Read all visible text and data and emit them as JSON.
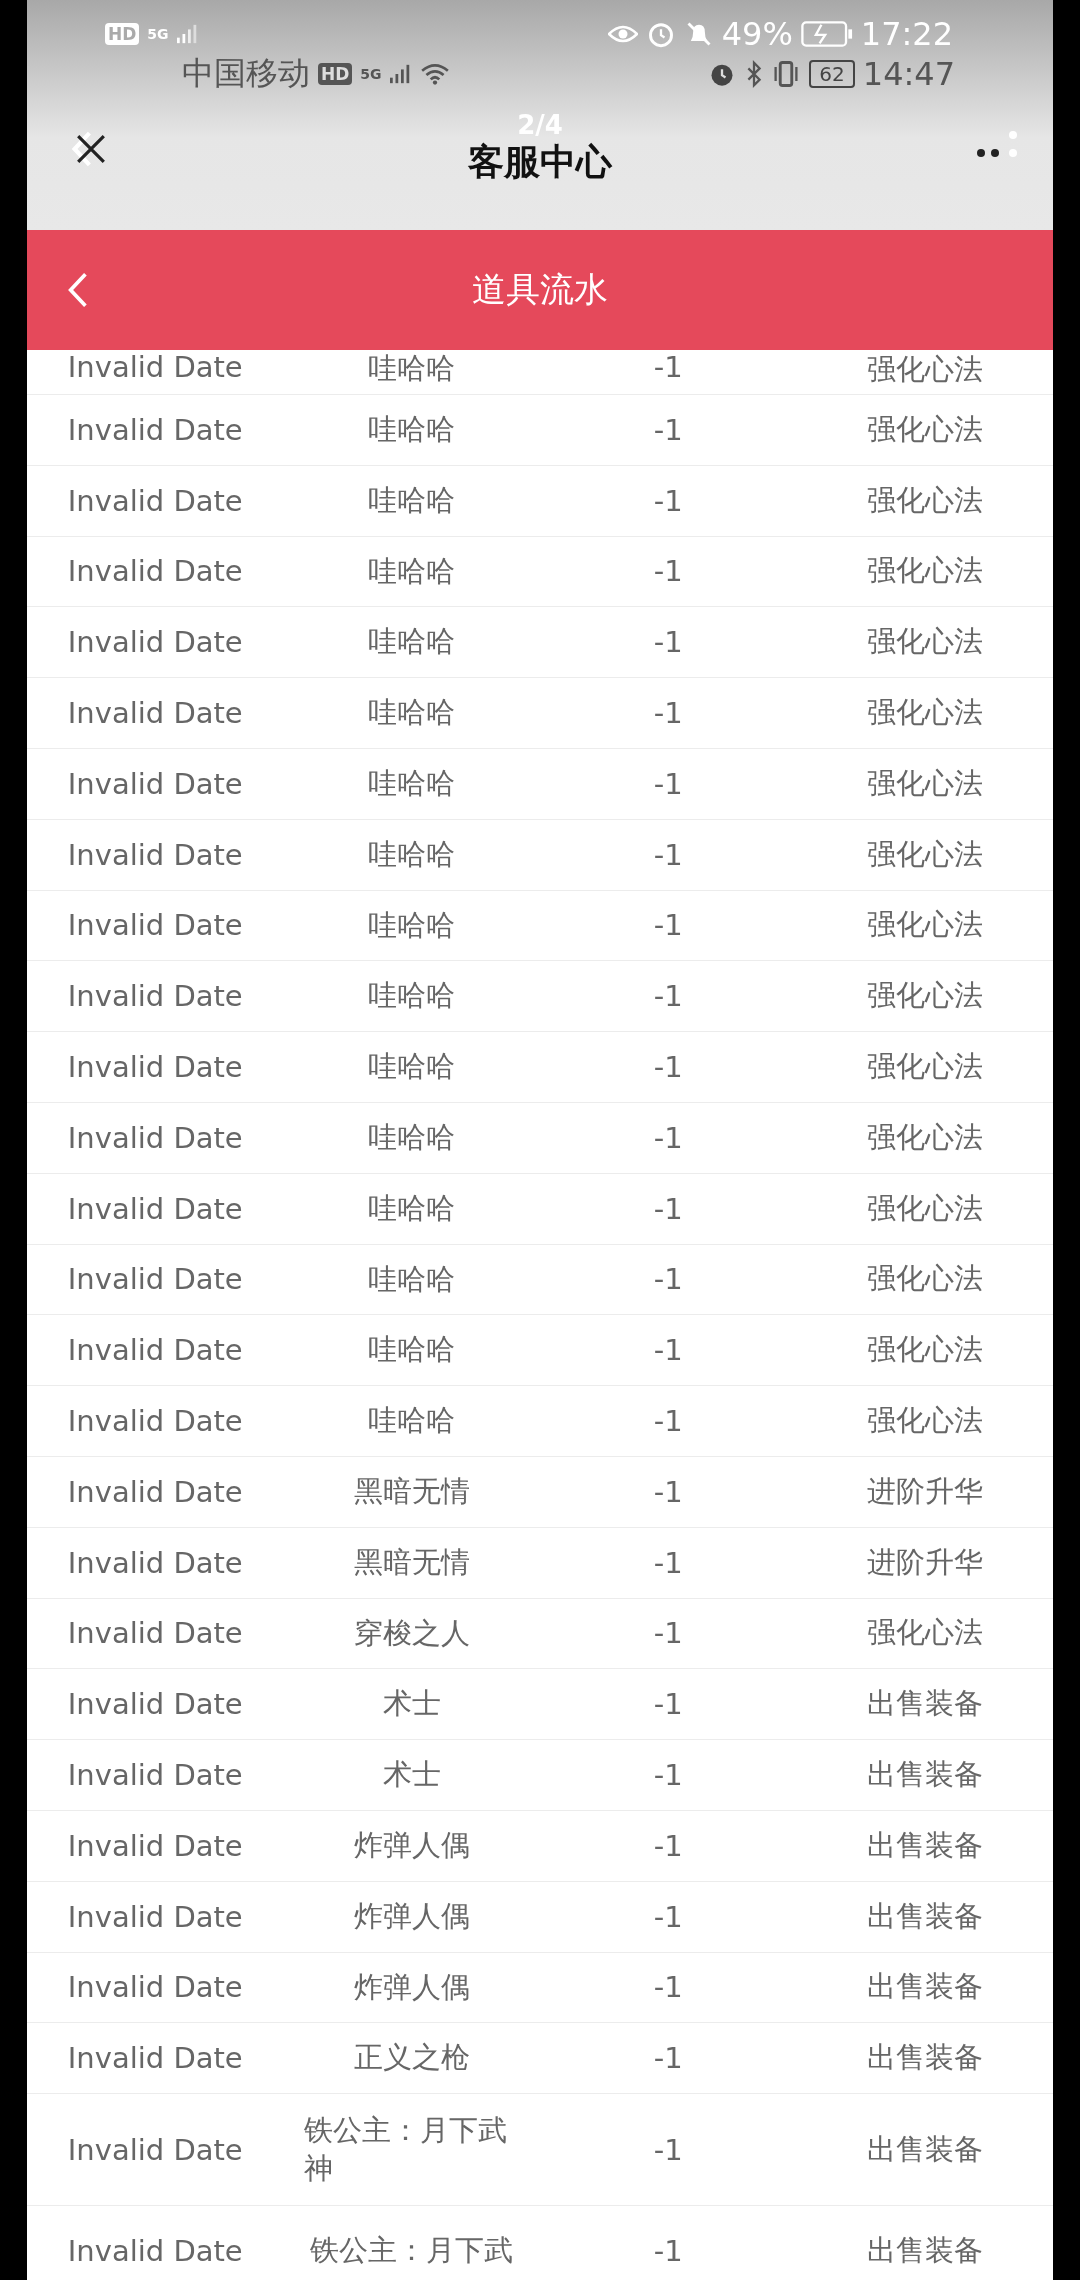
{
  "status_bar_overlay": {
    "badge": "HD",
    "network": "5G",
    "battery": "49%",
    "time": "17:22"
  },
  "status_bar": {
    "carrier": "中国移动",
    "badge": "HD",
    "network": "5G",
    "battery": "62",
    "time": "14:47"
  },
  "page_header": {
    "title": "客服中心",
    "overlay_counter": "2/4"
  },
  "nav_bar": {
    "title": "道具流水"
  },
  "rows": [
    {
      "date": "Invalid Date",
      "item": "哇哈哈",
      "count": "-1",
      "reason": "强化心法"
    },
    {
      "date": "Invalid Date",
      "item": "哇哈哈",
      "count": "-1",
      "reason": "强化心法"
    },
    {
      "date": "Invalid Date",
      "item": "哇哈哈",
      "count": "-1",
      "reason": "强化心法"
    },
    {
      "date": "Invalid Date",
      "item": "哇哈哈",
      "count": "-1",
      "reason": "强化心法"
    },
    {
      "date": "Invalid Date",
      "item": "哇哈哈",
      "count": "-1",
      "reason": "强化心法"
    },
    {
      "date": "Invalid Date",
      "item": "哇哈哈",
      "count": "-1",
      "reason": "强化心法"
    },
    {
      "date": "Invalid Date",
      "item": "哇哈哈",
      "count": "-1",
      "reason": "强化心法"
    },
    {
      "date": "Invalid Date",
      "item": "哇哈哈",
      "count": "-1",
      "reason": "强化心法"
    },
    {
      "date": "Invalid Date",
      "item": "哇哈哈",
      "count": "-1",
      "reason": "强化心法"
    },
    {
      "date": "Invalid Date",
      "item": "哇哈哈",
      "count": "-1",
      "reason": "强化心法"
    },
    {
      "date": "Invalid Date",
      "item": "哇哈哈",
      "count": "-1",
      "reason": "强化心法"
    },
    {
      "date": "Invalid Date",
      "item": "哇哈哈",
      "count": "-1",
      "reason": "强化心法"
    },
    {
      "date": "Invalid Date",
      "item": "哇哈哈",
      "count": "-1",
      "reason": "强化心法"
    },
    {
      "date": "Invalid Date",
      "item": "哇哈哈",
      "count": "-1",
      "reason": "强化心法"
    },
    {
      "date": "Invalid Date",
      "item": "哇哈哈",
      "count": "-1",
      "reason": "强化心法"
    },
    {
      "date": "Invalid Date",
      "item": "哇哈哈",
      "count": "-1",
      "reason": "强化心法"
    },
    {
      "date": "Invalid Date",
      "item": "黑暗无情",
      "count": "-1",
      "reason": "进阶升华"
    },
    {
      "date": "Invalid Date",
      "item": "黑暗无情",
      "count": "-1",
      "reason": "进阶升华"
    },
    {
      "date": "Invalid Date",
      "item": "穿梭之人",
      "count": "-1",
      "reason": "强化心法"
    },
    {
      "date": "Invalid Date",
      "item": "术士",
      "count": "-1",
      "reason": "出售装备"
    },
    {
      "date": "Invalid Date",
      "item": "术士",
      "count": "-1",
      "reason": "出售装备"
    },
    {
      "date": "Invalid Date",
      "item": "炸弹人偶",
      "count": "-1",
      "reason": "出售装备"
    },
    {
      "date": "Invalid Date",
      "item": "炸弹人偶",
      "count": "-1",
      "reason": "出售装备"
    },
    {
      "date": "Invalid Date",
      "item": "炸弹人偶",
      "count": "-1",
      "reason": "出售装备"
    },
    {
      "date": "Invalid Date",
      "item": "正义之枪",
      "count": "-1",
      "reason": "出售装备"
    },
    {
      "date": "Invalid Date",
      "item": "铁公主：月下武神",
      "count": "-1",
      "reason": "出售装备"
    },
    {
      "date": "Invalid Date",
      "item": "铁公主：月下武",
      "count": "-1",
      "reason": "出售装备"
    }
  ]
}
